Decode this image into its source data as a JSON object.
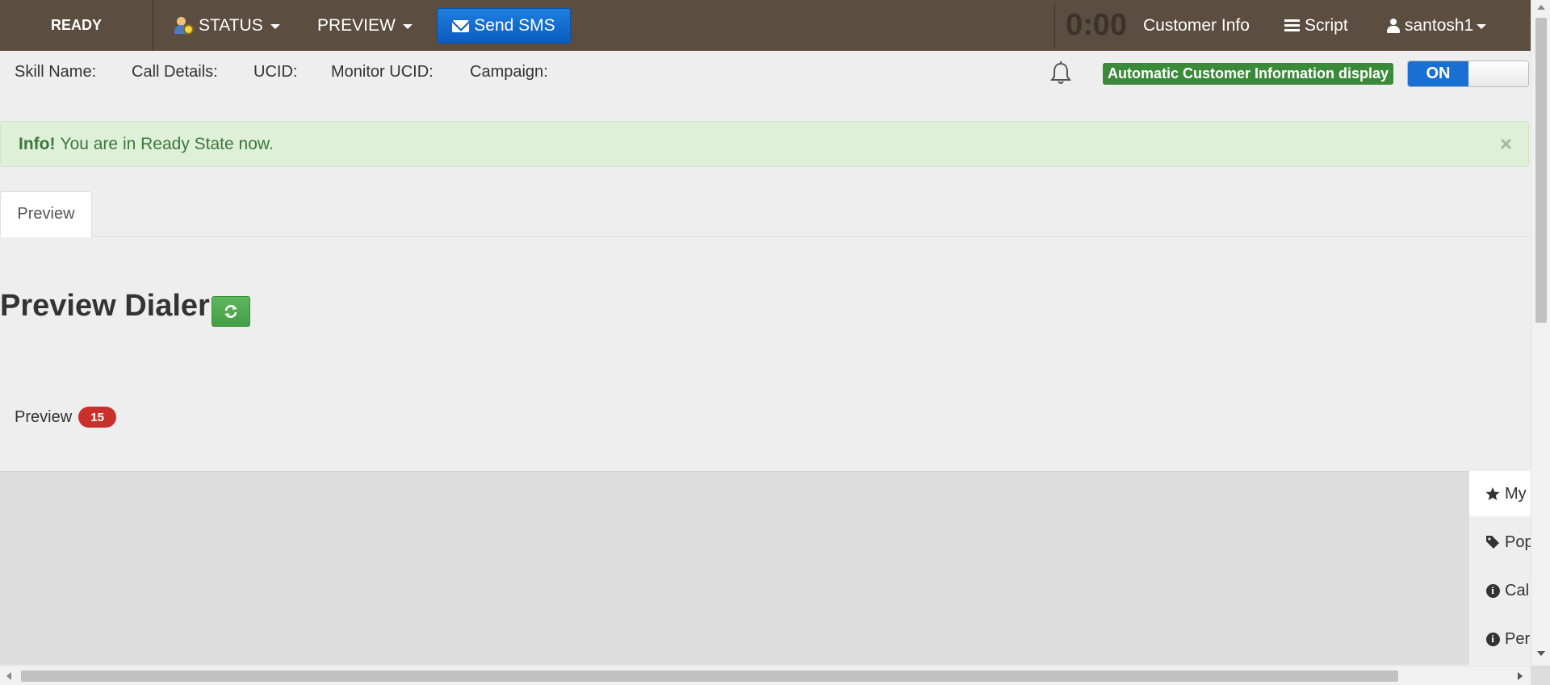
{
  "topbar": {
    "state": "READY",
    "status_label": "STATUS",
    "preview_label": "PREVIEW",
    "sms_label": "Send SMS",
    "timer": "0:00",
    "customer_info_label": "Customer Info",
    "script_label": "Script",
    "username": "santosh1"
  },
  "call_info": {
    "skill_name": "Skill Name:",
    "call_details": "Call Details:",
    "ucid": "UCID:",
    "monitor_ucid": "Monitor UCID:",
    "campaign": "Campaign:"
  },
  "auto_info": {
    "label": "Automatic Customer Information display",
    "toggle_state": "ON"
  },
  "alert": {
    "title": "Info!",
    "message": "You are in Ready State now.",
    "close": "×"
  },
  "tabs": [
    {
      "label": "Preview"
    }
  ],
  "page": {
    "title": "Preview Dialer",
    "preview_label": "Preview",
    "preview_count": "15"
  },
  "side_tabs": [
    {
      "label": "My",
      "icon": "star-icon"
    },
    {
      "label": "Pop",
      "icon": "tag-icon"
    },
    {
      "label": "Cal",
      "icon": "info-icon"
    },
    {
      "label": "Per",
      "icon": "info-icon"
    }
  ],
  "colors": {
    "topbar": "#5b4d40",
    "sms_button": "#0b5cc0",
    "auto_label": "#3a8a3a",
    "toggle_on": "#1a6fd3",
    "alert_bg": "#dff0d8",
    "alert_text": "#3c763d",
    "badge": "#c9302c",
    "refresh_button": "#5cb85c"
  }
}
